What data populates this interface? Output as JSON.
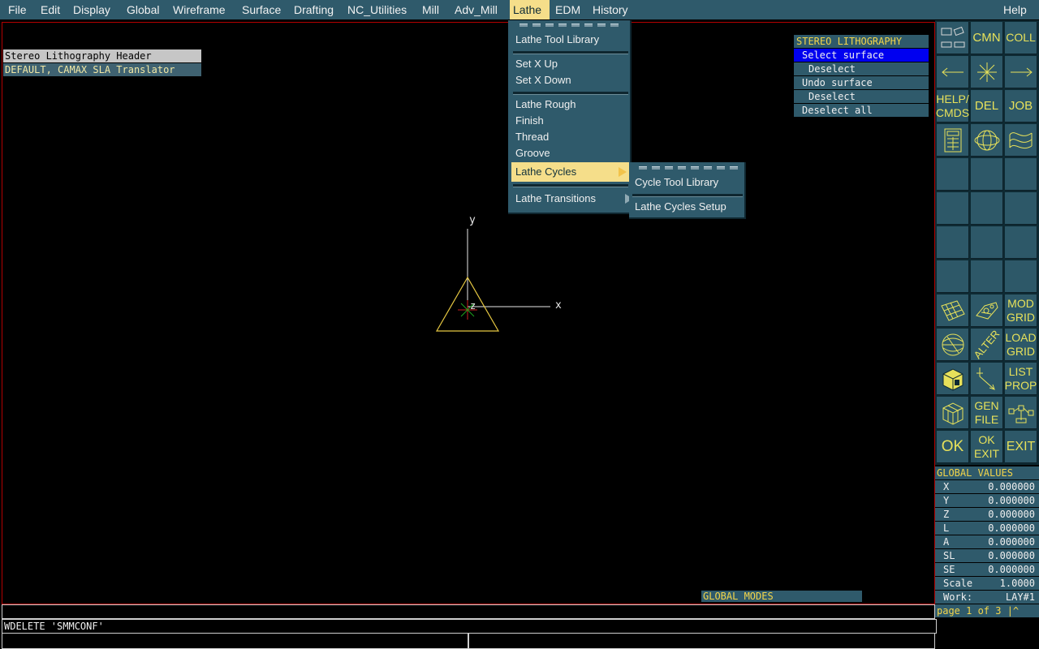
{
  "menubar": {
    "items": [
      "File",
      "Edit",
      "Display",
      "Global",
      "Wireframe",
      "Surface",
      "Drafting",
      "NC_Utilities",
      "Mill",
      "Adv_Mill",
      "Lathe",
      "EDM",
      "History"
    ],
    "help": "Help",
    "active": "Lathe"
  },
  "header": {
    "title": "Stereo Lithography Header",
    "value": "DEFAULT, CAMAX SLA Translator"
  },
  "axes": {
    "x": "x",
    "y": "y",
    "z": "z"
  },
  "lathe_menu": {
    "items": [
      "Lathe Tool Library",
      "Set X Up",
      "Set X Down",
      "Lathe Rough",
      "Finish",
      "Thread",
      "Groove",
      "Lathe Cycles",
      "Lathe Transitions"
    ],
    "highlighted": "Lathe Cycles"
  },
  "submenu": {
    "items": [
      "Cycle Tool Library",
      "Lathe Cycles Setup"
    ]
  },
  "stereo_panel": {
    "title": "STEREO LITHOGRAPHY",
    "items": [
      "Select surface",
      "Deselect",
      "Undo surface",
      "Deselect",
      "Deselect all"
    ],
    "selected": "Select surface"
  },
  "toolbox": {
    "labels": {
      "cmn": "CMN",
      "coll": "COLL",
      "help_cmds": "HELP/ CMDS",
      "del": "DEL",
      "job": "JOB",
      "mod_grid": "MOD GRID",
      "alter": "ALTER",
      "load_grid": "LOAD GRID",
      "list_prop": "LIST PROP",
      "gen_file": "GEN FILE",
      "ok": "OK",
      "ok_exit": "OK EXIT",
      "exit": "EXIT"
    }
  },
  "global_values": {
    "title": "GLOBAL VALUES",
    "rows": [
      {
        "k": "X",
        "v": "0.000000"
      },
      {
        "k": "Y",
        "v": "0.000000"
      },
      {
        "k": "Z",
        "v": "0.000000"
      },
      {
        "k": "L",
        "v": "0.000000"
      },
      {
        "k": "A",
        "v": "0.000000"
      },
      {
        "k": "SL",
        "v": "0.000000"
      },
      {
        "k": "SE",
        "v": "0.000000"
      },
      {
        "k": "Scale",
        "v": "1.0000"
      },
      {
        "k": "Work:",
        "v": "LAY#1"
      }
    ],
    "page": "page 1 of 3 |^"
  },
  "global_modes": "GLOBAL MODES",
  "command": {
    "line1": "",
    "line2": "WDELETE 'SMMCONF'"
  },
  "colors": {
    "panel": "#2f5a6b",
    "highlight": "#f5de8a",
    "select": "#0000f0",
    "yellow_text": "#f3d54a",
    "viewport_border": "#b30000"
  }
}
